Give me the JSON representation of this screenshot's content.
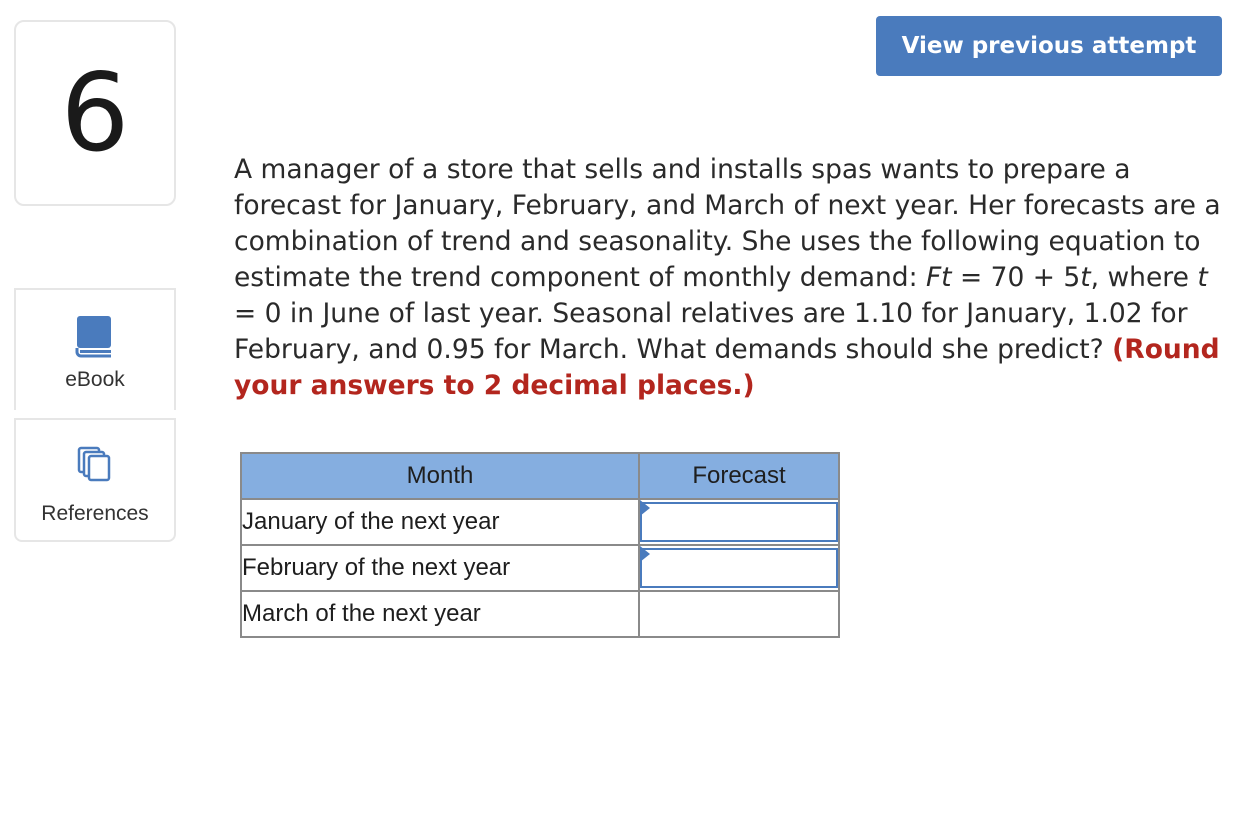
{
  "question": {
    "number": "6",
    "text_parts": {
      "p1": "A manager of a store that sells and installs spas wants to prepare a forecast for January, February, and March of next year. Her forecasts are a combination of trend and seasonality. She uses the following equation to estimate the trend component of monthly demand: ",
      "ft_var": "Ft",
      "p2": " = 70 + 5",
      "t_var1": "t",
      "p3": ", where ",
      "t_var2": "t",
      "p4": " = 0 in June of last year. Seasonal relatives are 1.10 for January, 1.02 for February, and 0.95 for March. What demands should she predict? ",
      "instruction": "(Round your answers to 2 decimal places.)"
    }
  },
  "header": {
    "view_previous_label": "View previous attempt"
  },
  "sidebar": {
    "ebook_label": "eBook",
    "references_label": "References"
  },
  "table": {
    "headers": {
      "month": "Month",
      "forecast": "Forecast"
    },
    "rows": [
      {
        "month": "January of the next year",
        "forecast": ""
      },
      {
        "month": "February of the next year",
        "forecast": ""
      },
      {
        "month": "March of the next year",
        "forecast": ""
      }
    ]
  },
  "colors": {
    "accent": "#4a7bbd",
    "header_fill": "#85aee0",
    "instruction": "#b3261e"
  }
}
